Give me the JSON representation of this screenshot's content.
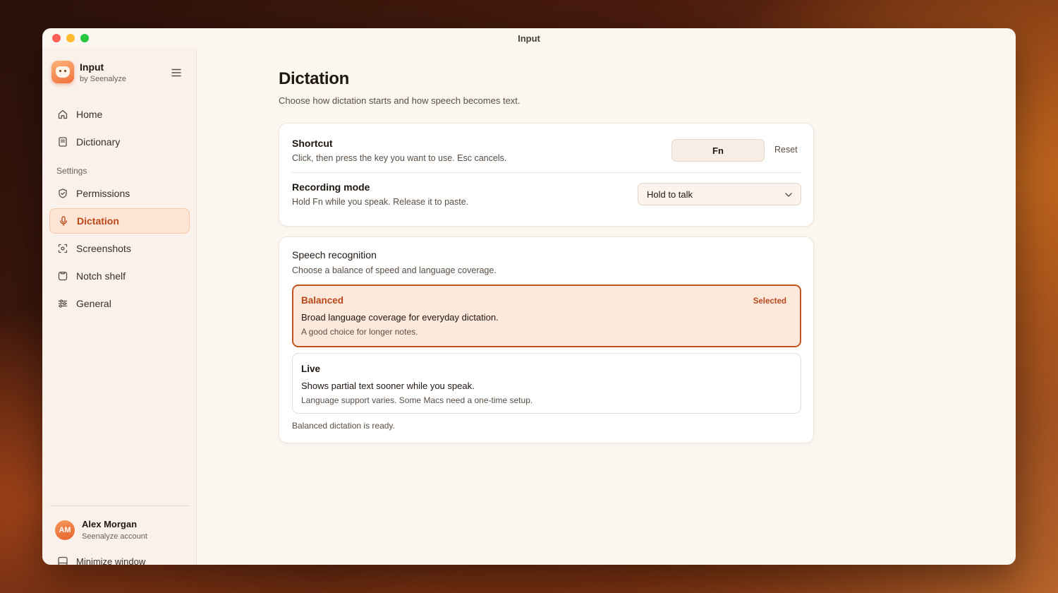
{
  "window": {
    "title": "Input"
  },
  "brand": {
    "name": "Input",
    "sub": "by Seenalyze"
  },
  "nav": {
    "items": [
      {
        "label": "Home",
        "icon": "home-icon"
      },
      {
        "label": "Dictionary",
        "icon": "book-icon"
      }
    ],
    "section_label": "Settings",
    "settings_items": [
      {
        "label": "Permissions",
        "icon": "shield-icon"
      },
      {
        "label": "Dictation",
        "icon": "microphone-icon",
        "active": true
      },
      {
        "label": "Screenshots",
        "icon": "screenshot-icon"
      },
      {
        "label": "Notch shelf",
        "icon": "shelf-icon"
      },
      {
        "label": "General",
        "icon": "sliders-icon"
      }
    ]
  },
  "user": {
    "initials": "AM",
    "name": "Alex Morgan",
    "account": "Seenalyze account"
  },
  "footer": {
    "minimize_label": "Minimize window"
  },
  "page": {
    "title": "Dictation",
    "subtitle": "Choose how dictation starts and how speech becomes text."
  },
  "shortcut": {
    "title": "Shortcut",
    "description": "Click, then press the key you want to use. Esc cancels.",
    "key": "Fn",
    "reset_label": "Reset"
  },
  "recording": {
    "title": "Recording mode",
    "description": "Hold Fn while you speak. Release it to paste.",
    "selected": "Hold to talk"
  },
  "speech": {
    "title": "Speech recognition",
    "subtitle": "Choose a balance of speed and language coverage.",
    "options": [
      {
        "name": "Balanced",
        "description": "Broad language coverage for everyday dictation.",
        "note": "A good choice for longer notes.",
        "badge": "Selected"
      },
      {
        "name": "Live",
        "description": "Shows partial text sooner while you speak.",
        "note": "Language support varies. Some Macs need a one-time setup."
      }
    ],
    "status": "Balanced dictation is ready."
  },
  "colors": {
    "accent": "#b8481a",
    "accent_bg": "#fde8dc",
    "accent_border": "#c4541f",
    "window_bg": "#fcf6f1"
  }
}
